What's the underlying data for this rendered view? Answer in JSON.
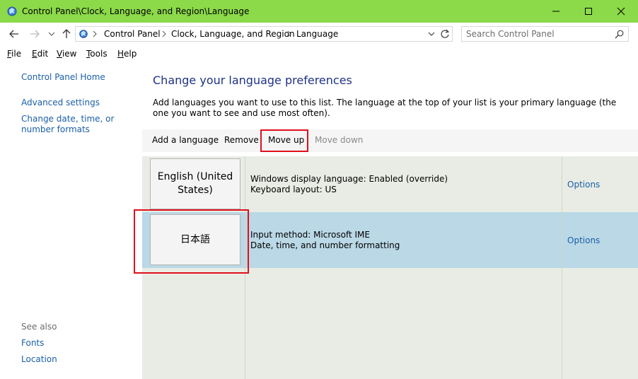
{
  "window": {
    "title": "Control Panel\\Clock, Language, and Region\\Language",
    "accent": "#8cd94a"
  },
  "address": {
    "crumbs": [
      "Control Panel",
      "Clock, Language, and Region",
      "Language"
    ],
    "search_placeholder": "Search Control Panel"
  },
  "menu": {
    "items": [
      {
        "acc": "F",
        "rest": "ile"
      },
      {
        "acc": "E",
        "rest": "dit"
      },
      {
        "acc": "V",
        "rest": "iew"
      },
      {
        "acc": "T",
        "rest": "ools"
      },
      {
        "acc": "H",
        "rest": "elp"
      }
    ]
  },
  "sidebar": {
    "home": "Control Panel Home",
    "advanced": "Advanced settings",
    "change_date": "Change date, time, or number formats",
    "see_also": "See also",
    "fonts": "Fonts",
    "location": "Location"
  },
  "main": {
    "heading": "Change your language preferences",
    "description": "Add languages you want to use to this list. The language at the top of your list is your primary language (the one you want to see and use most often)."
  },
  "toolbar": {
    "add": "Add a language",
    "remove": "Remove",
    "move_up": "Move up",
    "move_down": "Move down"
  },
  "languages": [
    {
      "name": "English (United States)",
      "line1": "Windows display language: Enabled (override)",
      "line2": "Keyboard layout: US",
      "options": "Options",
      "selected": false
    },
    {
      "name": "日本語",
      "line1": "Input method: Microsoft IME",
      "line2": "Date, time, and number formatting",
      "options": "Options",
      "selected": true
    }
  ]
}
